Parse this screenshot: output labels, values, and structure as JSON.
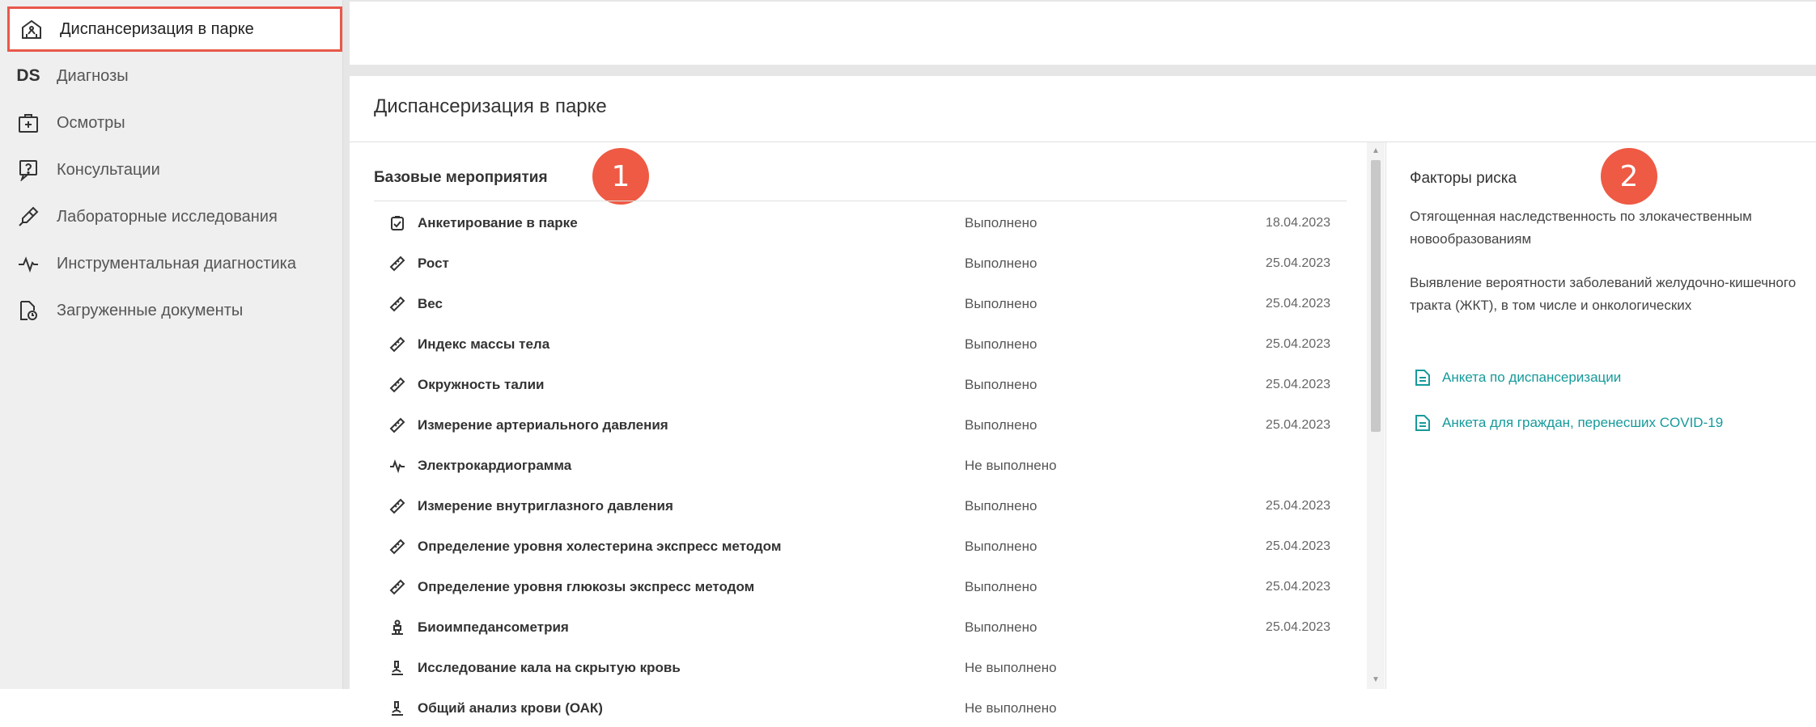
{
  "sidebar": {
    "items": [
      {
        "label": "Диспансеризация в парке",
        "icon": "clinic-icon",
        "active": true
      },
      {
        "label": "Диагнозы",
        "icon": "ds-icon",
        "icon_text": "DS"
      },
      {
        "label": "Осмотры",
        "icon": "medical-case-icon"
      },
      {
        "label": "Консультации",
        "icon": "chat-question-icon"
      },
      {
        "label": "Лабораторные исследования",
        "icon": "pipette-icon"
      },
      {
        "label": "Инструментальная диагностика",
        "icon": "pulse-icon"
      },
      {
        "label": "Загруженные документы",
        "icon": "document-icon"
      }
    ]
  },
  "main": {
    "title": "Диспансеризация в парке",
    "base": {
      "title": "Базовые мероприятия",
      "badge": "1",
      "rows": [
        {
          "name": "Анкетирование в парке",
          "status": "Выполнено",
          "date": "18.04.2023",
          "icon": "checklist-icon"
        },
        {
          "name": "Рост",
          "status": "Выполнено",
          "date": "25.04.2023",
          "icon": "ruler-icon"
        },
        {
          "name": "Вес",
          "status": "Выполнено",
          "date": "25.04.2023",
          "icon": "ruler-icon"
        },
        {
          "name": "Индекс массы тела",
          "status": "Выполнено",
          "date": "25.04.2023",
          "icon": "ruler-icon"
        },
        {
          "name": "Окружность талии",
          "status": "Выполнено",
          "date": "25.04.2023",
          "icon": "ruler-icon"
        },
        {
          "name": "Измерение артериального давления",
          "status": "Выполнено",
          "date": "25.04.2023",
          "icon": "ruler-icon"
        },
        {
          "name": "Электрокардиограмма",
          "status": "Не выполнено",
          "date": "",
          "icon": "pulse-icon"
        },
        {
          "name": "Измерение внутриглазного давления",
          "status": "Выполнено",
          "date": "25.04.2023",
          "icon": "ruler-icon"
        },
        {
          "name": "Определение уровня холестерина экспресс методом",
          "status": "Выполнено",
          "date": "25.04.2023",
          "icon": "ruler-icon"
        },
        {
          "name": "Определение уровня глюкозы экспресс методом",
          "status": "Выполнено",
          "date": "25.04.2023",
          "icon": "ruler-icon"
        },
        {
          "name": "Биоимпедансометрия",
          "status": "Выполнено",
          "date": "25.04.2023",
          "icon": "person-scale-icon"
        },
        {
          "name": "Исследование кала на скрытую кровь",
          "status": "Не выполнено",
          "date": "",
          "icon": "microscope-icon"
        },
        {
          "name": "Общий анализ крови (ОАК)",
          "status": "Не выполнено",
          "date": "",
          "icon": "microscope-icon"
        }
      ]
    },
    "risk": {
      "title": "Факторы риска",
      "badge": "2",
      "items": [
        "Отягощенная наследственность по злокачественным новообразованиям",
        "Выявление вероятности заболеваний желудочно-кишечного тракта (ЖКТ), в том числе и онкологических"
      ],
      "links": [
        "Анкета по диспансеризации",
        "Анкета для граждан, перенесших COVID-19"
      ]
    }
  },
  "colors": {
    "accent": "#ee5a44",
    "link": "#169a9b",
    "active_border": "#e8584a"
  }
}
